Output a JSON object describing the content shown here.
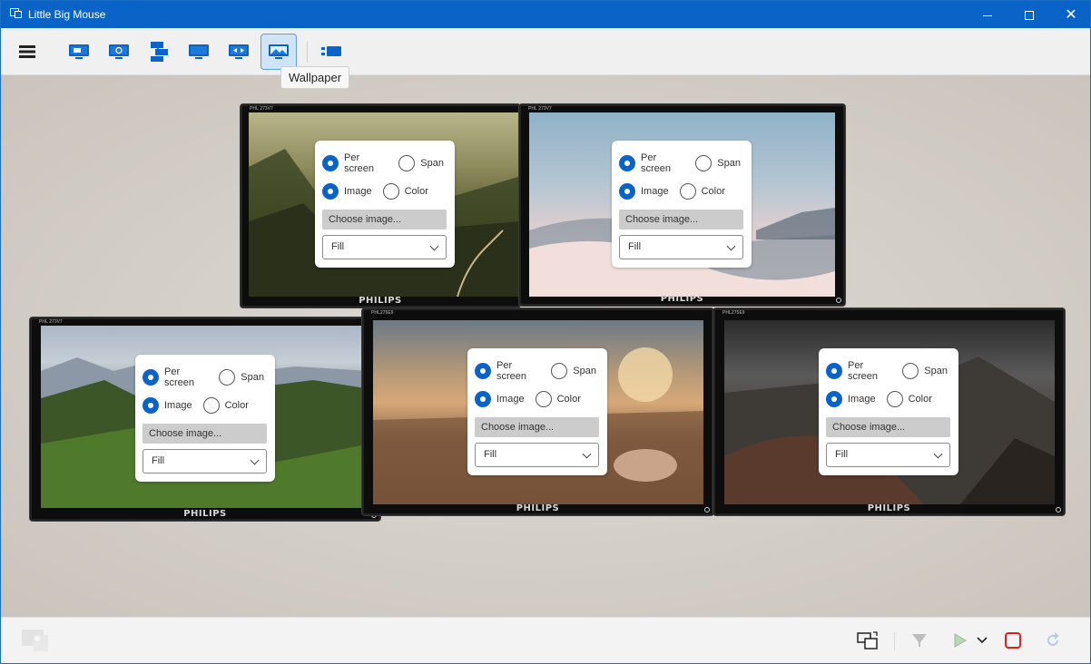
{
  "window": {
    "title": "Little Big Mouse"
  },
  "toolbar": {
    "items": [
      {
        "name": "menu-button",
        "icon": "hamburger-icon"
      },
      {
        "name": "location-button",
        "icon": "monitor-location-icon"
      },
      {
        "name": "size-button",
        "icon": "monitor-size-icon"
      },
      {
        "name": "arrange-button",
        "icon": "monitor-arrange-icon"
      },
      {
        "name": "border-button",
        "icon": "monitor-border-icon"
      },
      {
        "name": "resolution-button",
        "icon": "monitor-resolution-icon"
      },
      {
        "name": "wallpaper-button",
        "icon": "wallpaper-icon",
        "active": true
      },
      {
        "name": "list-button",
        "icon": "monitor-list-icon"
      }
    ],
    "tooltip": "Wallpaper"
  },
  "monitors": [
    {
      "brand": "PHILIPS",
      "model": "PHL 273V7",
      "options": {
        "per_screen": "Per screen",
        "span": "Span",
        "image": "Image",
        "color": "Color",
        "choose": "Choose image...",
        "fill": "Fill"
      }
    },
    {
      "brand": "PHILIPS",
      "model": "PHL 273V7",
      "options": {
        "per_screen": "Per screen",
        "span": "Span",
        "image": "Image",
        "color": "Color",
        "choose": "Choose image...",
        "fill": "Fill"
      }
    },
    {
      "brand": "PHILIPS",
      "model": "PHL 273V7",
      "options": {
        "per_screen": "Per screen",
        "span": "Span",
        "image": "Image",
        "color": "Color",
        "choose": "Choose image...",
        "fill": "Fill"
      }
    },
    {
      "brand": "PHILIPS",
      "model": "PHL275E9",
      "options": {
        "per_screen": "Per screen",
        "span": "Span",
        "image": "Image",
        "color": "Color",
        "choose": "Choose image...",
        "fill": "Fill"
      }
    },
    {
      "brand": "PHILIPS",
      "model": "PHL275E9",
      "options": {
        "per_screen": "Per screen",
        "span": "Span",
        "image": "Image",
        "color": "Color",
        "choose": "Choose image...",
        "fill": "Fill"
      }
    }
  ],
  "colors": {
    "accent": "#0a64c8",
    "titlebar": "#0a64c8",
    "stop": "#e02020"
  }
}
